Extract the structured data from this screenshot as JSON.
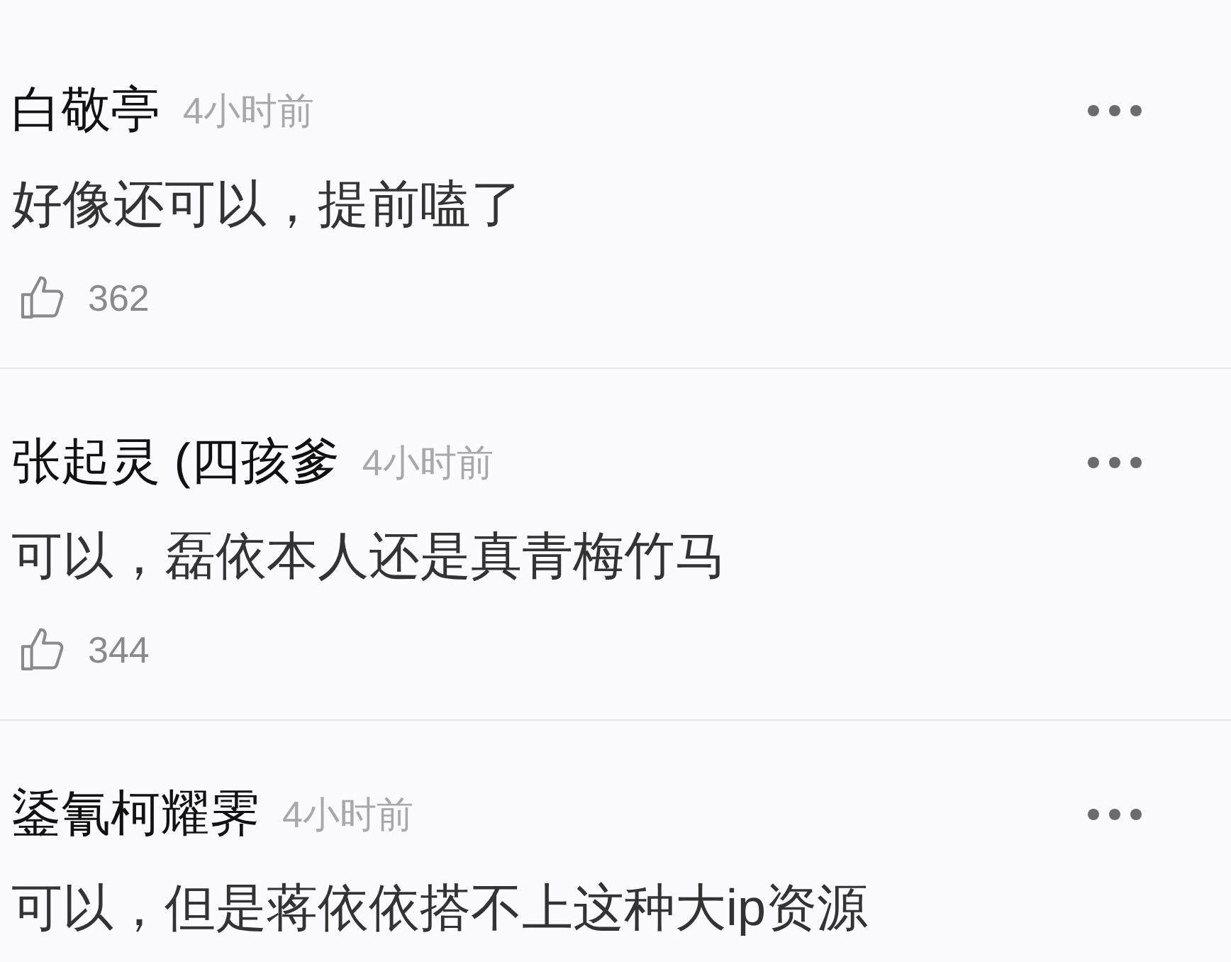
{
  "comments": [
    {
      "author": "白敬亭",
      "time": "4小时前",
      "text": "好像还可以，提前嗑了",
      "likes": "362"
    },
    {
      "author": "张起灵 (四孩爹",
      "time": "4小时前",
      "text": "可以，磊依本人还是真青梅竹马",
      "likes": "344"
    },
    {
      "author": "鋈氰柯耀霁",
      "time": "4小时前",
      "text": "可以，但是蒋依依搭不上这种大ip资源"
    }
  ]
}
